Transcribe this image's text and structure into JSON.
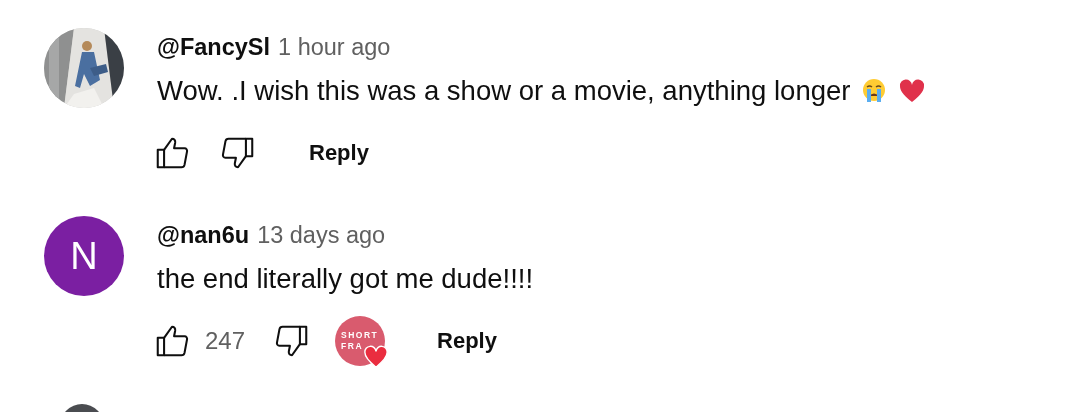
{
  "comments": [
    {
      "author": "@FancySl",
      "time": "1 hour ago",
      "text": "Wow. .I wish this was a show or a movie, anything longer",
      "emoji_icons": [
        {
          "kind": "crying"
        },
        {
          "kind": "heart"
        }
      ],
      "reply": "Reply"
    },
    {
      "avatar": {
        "kind": "letter",
        "letter": "N",
        "color": "#7b1fa2"
      },
      "author": "@nan6u",
      "time": "13 days ago",
      "text": "the end literally got me dude!!!!",
      "likes": "247",
      "creator_heart": {
        "badge_text": [
          "SHORT",
          "FRA"
        ]
      },
      "reply": "Reply"
    }
  ],
  "more_below": true
}
